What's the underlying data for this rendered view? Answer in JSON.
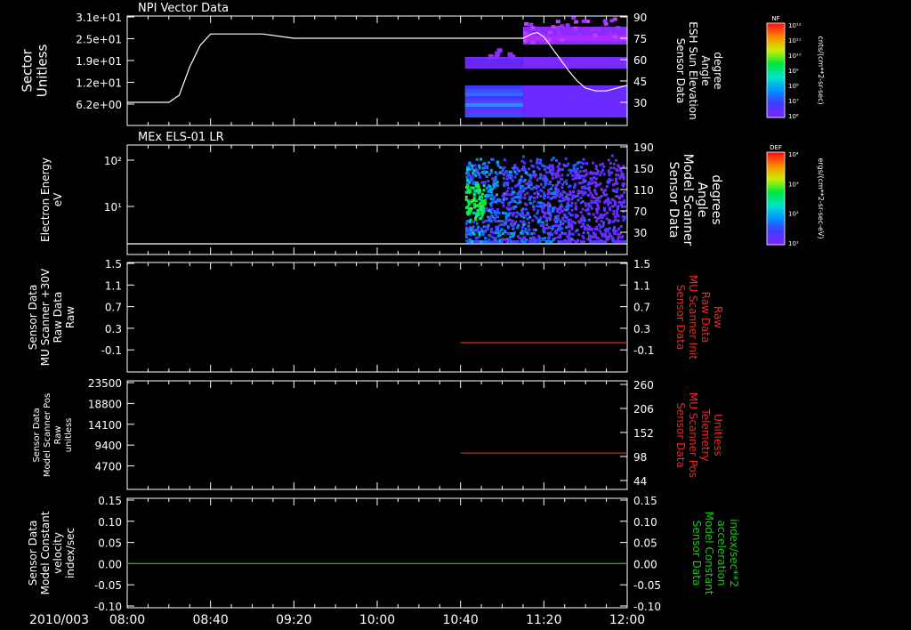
{
  "date_label": "2010/003",
  "x_ticks": [
    "08:00",
    "08:40",
    "09:20",
    "10:00",
    "10:40",
    "11:20",
    "12:00"
  ],
  "chart_data": [
    {
      "type": "heatmap",
      "title": "NPI Vector Data",
      "ylabel": [
        "Sector",
        "Unitless"
      ],
      "yticks": [
        "3.1e+01",
        "2.5e+01",
        "1.9e+01",
        "1.2e+01",
        "6.2e+00"
      ],
      "ylabel_right": [
        "Sensor Data",
        "ESH Sun Elevation",
        "Angle",
        "degree"
      ],
      "yticks_right": [
        "90",
        "75",
        "60",
        "45",
        "30"
      ],
      "ylim_right": [
        20,
        90
      ],
      "line_color": "#ffffff",
      "line": {
        "x": [
          "08:00",
          "08:20",
          "08:25",
          "08:30",
          "08:35",
          "08:40",
          "09:05",
          "09:15",
          "09:20",
          "10:00",
          "10:40",
          "11:10",
          "11:14",
          "11:17",
          "11:20",
          "11:24",
          "11:28",
          "11:32",
          "11:36",
          "11:40",
          "11:45",
          "11:50",
          "12:00"
        ],
        "y": [
          30,
          30,
          35,
          55,
          70,
          78,
          78,
          76,
          75,
          75,
          75,
          75,
          78,
          79,
          76,
          68,
          60,
          52,
          45,
          40,
          38,
          38,
          42
        ]
      },
      "colorbar": {
        "label": "NF",
        "units": "cnts/(cm**2-sr-sec)",
        "ticks": [
          "10¹²",
          "10¹¹",
          "10¹⁰",
          "10⁹",
          "10⁸",
          "10⁷",
          "10⁶"
        ]
      }
    },
    {
      "type": "heatmap",
      "title": "MEx ELS-01 LR",
      "ylabel": [
        "Electron Energy",
        "eV"
      ],
      "yscale": "log",
      "yticks": [
        "10²",
        "10¹"
      ],
      "ylabel_right": [
        "Sensor Data",
        "Model Scanner",
        "Angle",
        "degrees"
      ],
      "yticks_right": [
        "190",
        "150",
        "110",
        "70",
        "30"
      ],
      "ylim_right": [
        0,
        190
      ],
      "line_color": "#ffffff",
      "line": {
        "x": [
          "08:00",
          "12:00"
        ],
        "y": [
          3,
          3
        ]
      },
      "colorbar": {
        "label": "DEF",
        "units": "ergs/(cm**2-sr-sec-eV)",
        "ticks": [
          "10⁴",
          "10³",
          "10²",
          "10¹"
        ]
      }
    },
    {
      "type": "line",
      "ylabel": [
        "Sensor Data",
        "MU Scanner +30V",
        "Raw Data",
        "Raw"
      ],
      "yticks": [
        "1.5",
        "1.1",
        "0.7",
        "0.3",
        "-0.1"
      ],
      "ylim": [
        -0.4,
        1.5
      ],
      "ylabel_right": [
        "Sensor Data",
        "MU Scanner Init",
        "Raw Data",
        "Raw"
      ],
      "yticks_right": [
        "1.5",
        "1.1",
        "0.7",
        "0.3",
        "-0.1"
      ],
      "line_color": "#ff2020",
      "line": {
        "x": [
          "10:40",
          "12:00"
        ],
        "y": [
          0.0,
          0.0
        ]
      }
    },
    {
      "type": "line",
      "ylabel": [
        "Sensor Data",
        "Model Scanner Pos",
        "Raw",
        "unitless"
      ],
      "yticks": [
        "23500",
        "18800",
        "14100",
        "9400",
        "4700"
      ],
      "ylim": [
        0,
        23500
      ],
      "ylabel_right": [
        "Sensor Data",
        "MU Scanner Pos",
        "Telemetry",
        "Unitless"
      ],
      "yticks_right": [
        "260",
        "206",
        "152",
        "98",
        "44"
      ],
      "line_color": "#ff2020",
      "line": {
        "x": [
          "10:40",
          "12:00"
        ],
        "y": [
          7600,
          7600
        ]
      }
    },
    {
      "type": "line",
      "ylabel": [
        "Sensor Data",
        "Model Constant",
        "velocity",
        "index/sec"
      ],
      "yticks": [
        "0.15",
        "0.10",
        "0.05",
        "0.00",
        "-0.05",
        "-0.10"
      ],
      "ylim": [
        -0.1,
        0.15
      ],
      "ylabel_right": [
        "Sensor Data",
        "Model Constant",
        "acceleration",
        "index/sec**2"
      ],
      "yticks_right": [
        "0.15",
        "0.10",
        "0.05",
        "0.00",
        "-0.05",
        "-0.10"
      ],
      "line_color": "#00cc00",
      "line": {
        "x": [
          "08:00",
          "12:00"
        ],
        "y": [
          0.0,
          0.0
        ]
      }
    }
  ]
}
